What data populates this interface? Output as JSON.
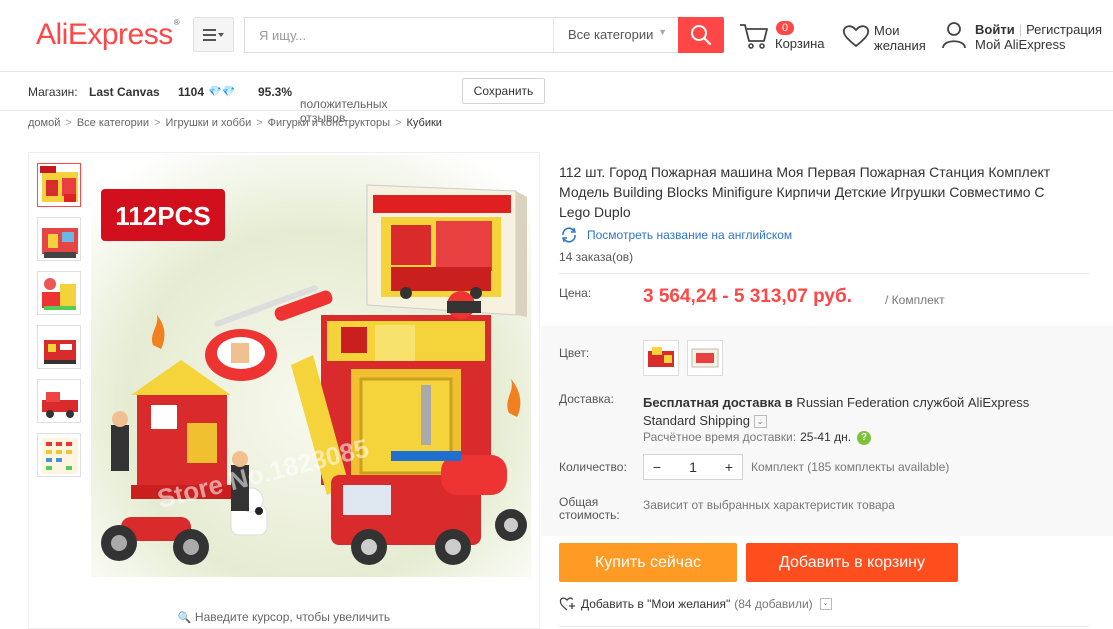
{
  "header": {
    "logo": "AliExpress",
    "logo_tm": "®",
    "search_placeholder": "Я ищу...",
    "search_category": "Все категории",
    "cart_count": "0",
    "cart_label": "Корзина",
    "wishlist_label_1": "Мои",
    "wishlist_label_2": "желания",
    "login": "Войти",
    "register": "Регистрация",
    "my_account": "Мой AliExpress"
  },
  "store": {
    "label": "Магазин:",
    "name": "Last Canvas",
    "score": "1104",
    "diamonds": "💎💎",
    "positive_rate": "95.3%",
    "positive_text": "положительных отзывов",
    "save_button": "Сохранить"
  },
  "breadcrumb": [
    "домой",
    "Все категории",
    "Игрушки и хобби",
    "Фигурки и конструкторы",
    "Кубики"
  ],
  "gallery": {
    "badge": "112PCS",
    "watermark": "Store No.1823085",
    "zoom_hint": "Наведите курсор, чтобы увеличить"
  },
  "product": {
    "title": "112 шт. Город Пожарная машина Моя Первая Пожарная Станция Комплект Модель Building Blocks Minifigure Кирпичи Детские Игрушки Совместимо С Lego Duplo",
    "translate_link": "Посмотреть название на английском",
    "orders": "14 заказа(ов)",
    "price_label": "Цена:",
    "price": "3 564,24 - 5 313,07 руб.",
    "price_unit": "/ Комплект",
    "color_label": "Цвет:",
    "shipping_label": "Доставка:",
    "shipping_free": "Бесплатная доставка в",
    "shipping_rest": " Russian Federation службой AliExpress Standard Shipping",
    "eta_label": "Расчётное время доставки:",
    "eta_days": "25-41 дн.",
    "help": "?",
    "qty_label": "Количество:",
    "qty_minus": "−",
    "qty_value": "1",
    "qty_plus": "+",
    "qty_note": "Комплект (185 комплекты available)",
    "total_label_1": "Общая",
    "total_label_2": "стоимость:",
    "total_value": "Зависит от выбранных характеристик товара",
    "buy_now": "Купить сейчас",
    "add_to_cart": "Добавить в корзину",
    "wishlist_add": "Добавить в \"Мои желания\"",
    "wishlist_count": "(84 добавили)"
  },
  "colors": {
    "brand": "#ff4747",
    "buy": "#ff9a24",
    "cart": "#ff4e1d",
    "link": "#2f76c8"
  }
}
